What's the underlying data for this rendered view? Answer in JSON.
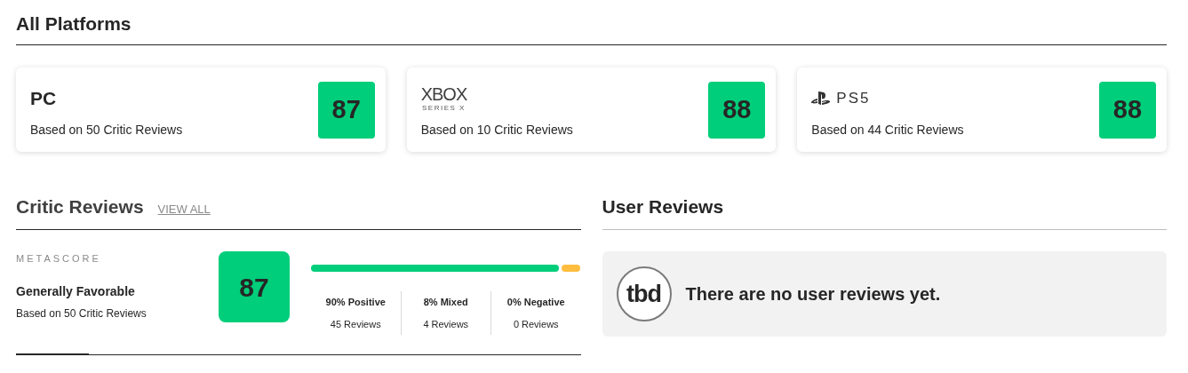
{
  "title": "All Platforms",
  "platforms": [
    {
      "kind": "text",
      "name": "PC",
      "reviews": "Based on 50 Critic Reviews",
      "score": "87"
    },
    {
      "kind": "xbox",
      "name": "XBOX",
      "subname": "SERIES X",
      "reviews": "Based on 10 Critic Reviews",
      "score": "88"
    },
    {
      "kind": "playstation",
      "name": "PS5",
      "reviews": "Based on 44 Critic Reviews",
      "score": "88"
    }
  ],
  "critic_reviews": {
    "title": "Critic Reviews",
    "link": "VIEW ALL",
    "label": "METASCORE",
    "verdict": "Generally Favorable",
    "reviews": "Based on 50 Critic Reviews",
    "score": "87",
    "breakdown": [
      {
        "kind": "positive",
        "label": "90% Positive",
        "count": "45 Reviews"
      },
      {
        "kind": "mixed",
        "label": "8% Mixed",
        "count": "4 Reviews"
      },
      {
        "kind": "negative",
        "label": "0% Negative",
        "count": "0 Reviews"
      }
    ]
  },
  "user_reviews": {
    "title": "User Reviews",
    "score": "tbd",
    "message": "There are no user reviews yet."
  }
}
